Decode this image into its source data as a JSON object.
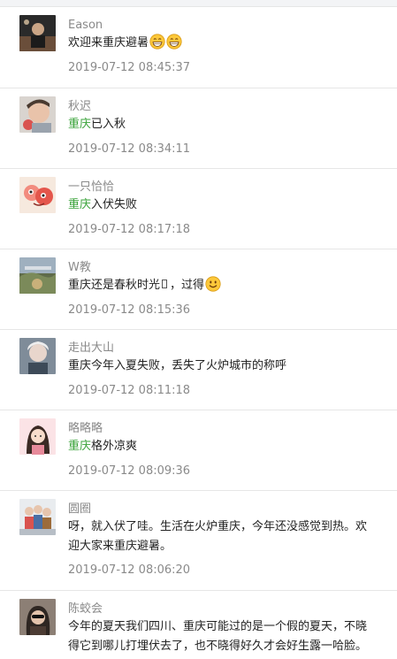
{
  "comments": [
    {
      "name": "Eason",
      "avatar_icon": "avatar-eason",
      "content_highlight": "",
      "content_text": "欢迎来重庆避暑",
      "content_emoji": [
        "grin-emoji",
        "grin-emoji"
      ],
      "time": "2019-07-12 08:45:37"
    },
    {
      "name": "秋迟",
      "avatar_icon": "avatar-qiuchi",
      "content_highlight": "重庆",
      "content_text": "已入秋",
      "time": "2019-07-12 08:34:11"
    },
    {
      "name": "一只恰恰",
      "avatar_icon": "avatar-yizhiqiaqia",
      "content_highlight": "重庆",
      "content_text": "入伏失败",
      "time": "2019-07-12 08:17:18"
    },
    {
      "name": "W教",
      "avatar_icon": "avatar-wjiao",
      "content_highlight": "",
      "content_text": "重庆还是春秋时光",
      "content_after_box": "，过得",
      "content_emoji": [
        "smile-emoji"
      ],
      "time": "2019-07-12 08:15:36"
    },
    {
      "name": "走出大山",
      "avatar_icon": "avatar-zouchudashan",
      "content_highlight": "",
      "content_text": "重庆今年入夏失败，丢失了火炉城市的称呼",
      "time": "2019-07-12 08:11:18"
    },
    {
      "name": "略略略",
      "avatar_icon": "avatar-lvelvelve",
      "content_highlight": "重庆",
      "content_text": "格外凉爽",
      "time": "2019-07-12 08:09:36"
    },
    {
      "name": "圆圈",
      "avatar_icon": "avatar-yuanquan",
      "content_highlight": "",
      "content_line1": "呀，就入伏了哇。生活在火炉重庆，今年还没感觉到热。欢",
      "content_line2": "迎大家来重庆避暑。",
      "time": "2019-07-12 08:06:20"
    },
    {
      "name": "陈蛟会",
      "avatar_icon": "avatar-chenjiaohui",
      "content_highlight": "",
      "content_line1": "今年的夏天我们四川、重庆可能过的是一个假的夏天，不晓",
      "content_line2": "得它到哪儿打埋伏去了，也不晓得好久才会好生露一哈脸。"
    }
  ],
  "colors": {
    "highlight": "#3aa33a",
    "meta_text": "#8a8a8a",
    "body_text": "#222222",
    "divider": "#e6e6e6"
  }
}
